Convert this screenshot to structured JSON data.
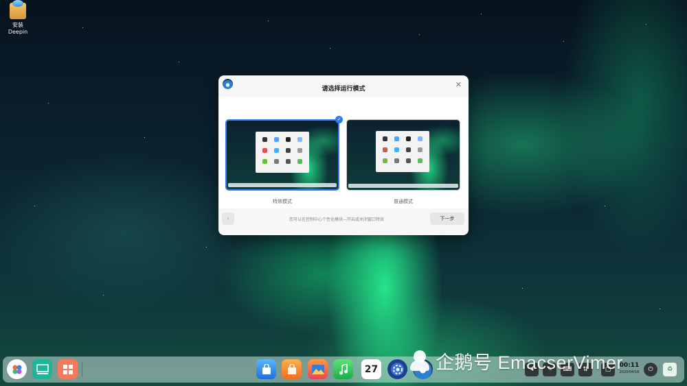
{
  "desktop": {
    "icons": [
      {
        "label_line1": "安装",
        "label_line2": "Deepin",
        "icon": "installer-box-icon"
      }
    ]
  },
  "dialog": {
    "title": "请选择运行模式",
    "close_icon": "close-icon",
    "modes": [
      {
        "label": "特效模式",
        "selected": true
      },
      {
        "label": "普通模式",
        "selected": false
      }
    ],
    "check_mark": "✓",
    "hint": "您可以在控制中心个性化模块—开启或关闭窗口特效",
    "back_label": "‹",
    "next_label": "下一步"
  },
  "dock": {
    "apps": [
      {
        "name": "launcher",
        "icon": "launcher-icon"
      },
      {
        "name": "multitask-view",
        "icon": "multitask-view-icon"
      },
      {
        "name": "show-desktop",
        "icon": "show-desktop-icon"
      },
      {
        "name": "app-store",
        "icon": "app-store-icon"
      },
      {
        "name": "shopping",
        "icon": "shopping-bag-icon"
      },
      {
        "name": "image-viewer",
        "icon": "image-viewer-icon"
      },
      {
        "name": "music",
        "icon": "music-icon"
      },
      {
        "name": "calendar",
        "icon": "calendar-icon",
        "day": "27"
      },
      {
        "name": "settings",
        "icon": "settings-icon"
      },
      {
        "name": "installer",
        "icon": "installer-icon"
      }
    ],
    "clock": {
      "time": "00:11",
      "date": "2020/04/16"
    },
    "tray": [
      {
        "name": "volume",
        "icon": "volume-icon"
      },
      {
        "name": "pen",
        "icon": "pen-icon"
      },
      {
        "name": "keyboard",
        "icon": "keyboard-icon"
      },
      {
        "name": "network",
        "icon": "network-icon"
      },
      {
        "name": "window",
        "icon": "window-icon"
      },
      {
        "name": "power",
        "icon": "power-icon"
      },
      {
        "name": "trash",
        "icon": "trash-icon"
      }
    ]
  },
  "watermark": {
    "text": "企鹅号 EmacserVimer"
  },
  "colors": {
    "accent": "#2e7bf0",
    "dialog_bg": "#f7f7f8"
  }
}
